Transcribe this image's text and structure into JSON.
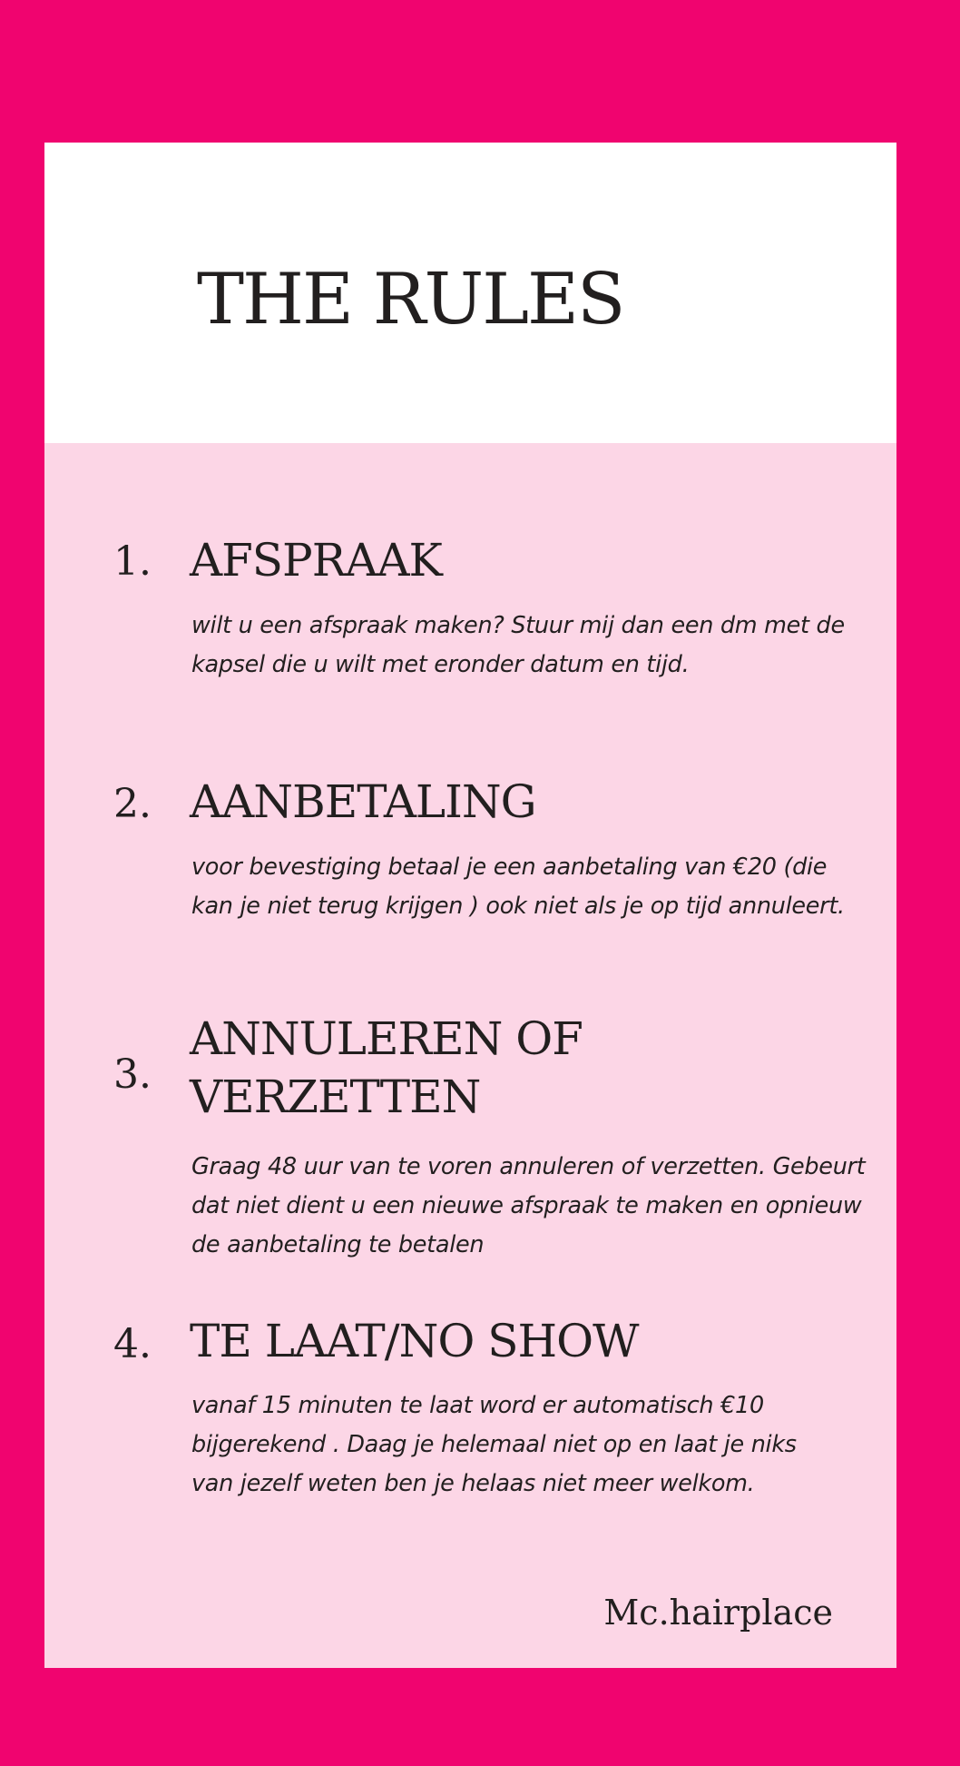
{
  "title": "THE RULES",
  "rules": [
    {
      "number": "1.",
      "heading": "AFSPRAAK",
      "body": "wilt u een afspraak maken? Stuur mij dan een dm met de kapsel die u wilt met eronder datum en tijd."
    },
    {
      "number": "2.",
      "heading": "AANBETALING",
      "body": "voor bevestiging betaal je een aanbetaling van €20 (die kan je niet terug krijgen ) ook niet als je op tijd annuleert."
    },
    {
      "number": "3.",
      "heading": "ANNULEREN OF VERZETTEN",
      "body": "Graag 48 uur van te voren annuleren of verzetten. Gebeurt dat niet dient u een nieuwe afspraak te maken en opnieuw de aanbetaling te betalen"
    },
    {
      "number": "4.",
      "heading": "TE LAAT/NO SHOW",
      "body": "vanaf 15 minuten te laat word er automatisch €10 bijgerekend . Daag je helemaal niet op en laat je niks van jezelf weten ben je helaas niet meer welkom."
    }
  ],
  "signature": "Mc.hairplace",
  "colors": {
    "background": "#f0046f",
    "card": "#fcd6e6",
    "header": "#ffffff",
    "text": "#221f1f"
  }
}
